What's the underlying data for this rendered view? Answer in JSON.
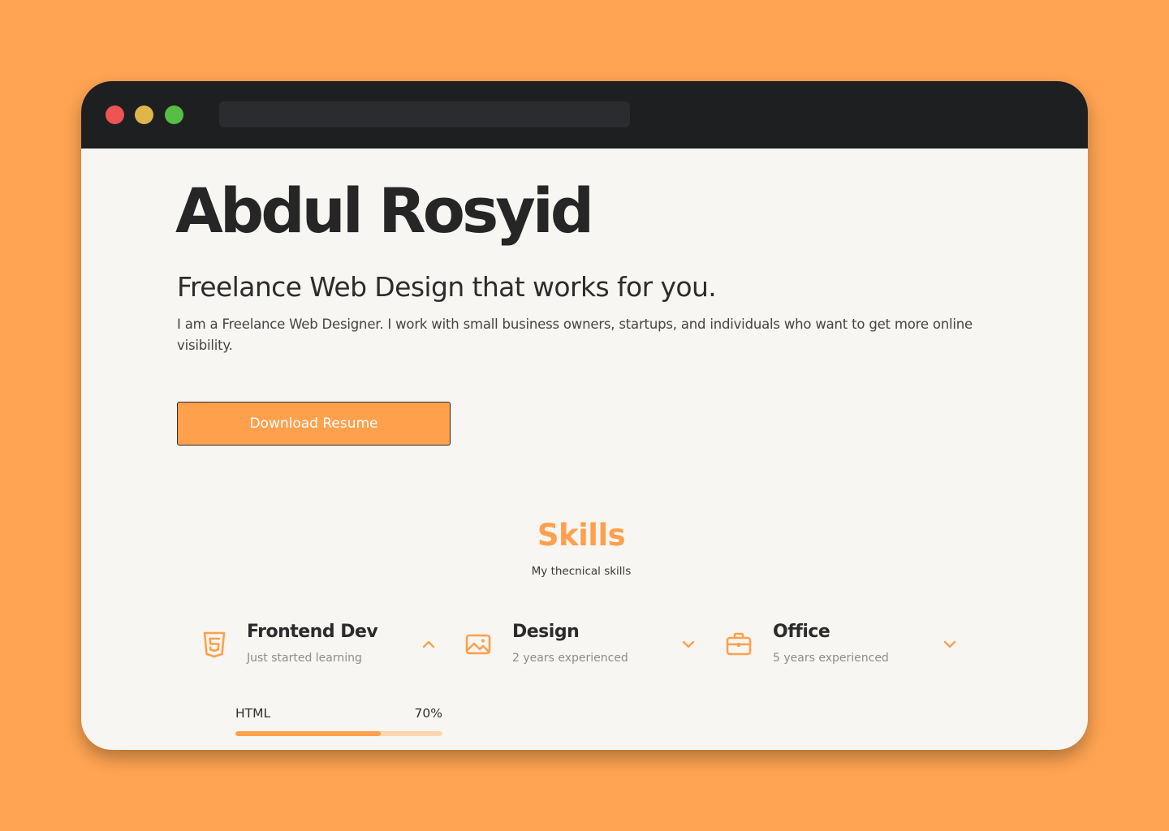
{
  "hero": {
    "name": "Abdul Rosyid",
    "subtitle": "Freelance Web Design that works for you.",
    "description": "I am a Freelance Web Designer. I work with small business owners, startups, and individuals who want to get more online visibility.",
    "button_label": "Download Resume"
  },
  "skills": {
    "title": "Skills",
    "subtitle": "My thecnical skills",
    "categories": [
      {
        "name": "Frontend Dev",
        "note": "Just started learning",
        "icon": "html5-icon",
        "expanded": true
      },
      {
        "name": "Design",
        "note": "2 years experienced",
        "icon": "image-icon",
        "expanded": false
      },
      {
        "name": "Office",
        "note": "5 years experienced",
        "icon": "briefcase-icon",
        "expanded": false
      }
    ],
    "bars": [
      {
        "label": "HTML",
        "percent_label": "70%",
        "value": 0.7
      }
    ]
  },
  "colors": {
    "background": "#FFA452",
    "accent": "#FFA04D",
    "titlebar": "#1E1F21",
    "page": "#F8F6F2",
    "dot_red": "#EE5451",
    "dot_yellow": "#E0B54A",
    "dot_green": "#56BE45"
  }
}
